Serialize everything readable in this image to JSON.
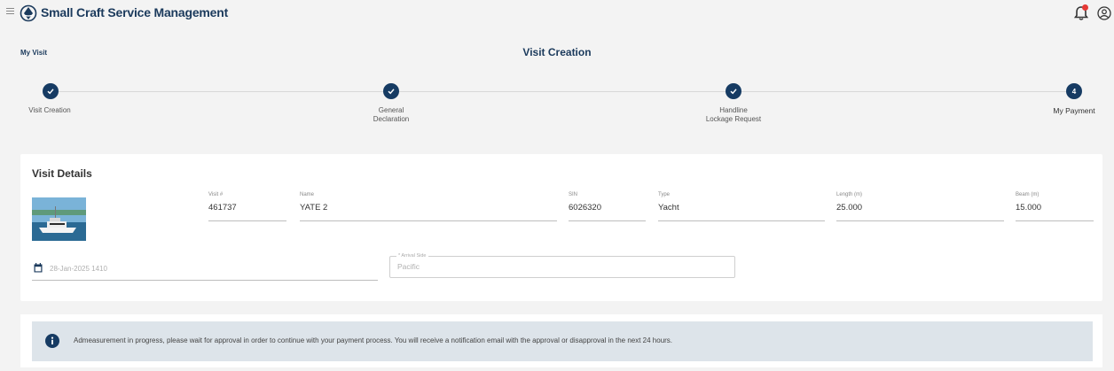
{
  "header": {
    "app_title": "Small Craft Service Management",
    "menu_icon": "hamburger-icon",
    "logo_icon": "ship-wheel-logo",
    "notification_icon": "bell-icon",
    "user_icon": "user-circle-icon"
  },
  "breadcrumb": "My Visit",
  "page_title": "Visit Creation",
  "stepper": {
    "steps": [
      {
        "label": "Visit Creation",
        "status": "done"
      },
      {
        "label": "General\nDeclaration",
        "status": "done"
      },
      {
        "label": "Handline\nLockage Request",
        "status": "done"
      },
      {
        "label": "My Payment",
        "status": "active",
        "number": "4"
      }
    ]
  },
  "visit_details": {
    "title": "Visit Details",
    "fields": [
      {
        "label": "Visit #",
        "value": "461737"
      },
      {
        "label": "Name",
        "value": "YATE 2"
      },
      {
        "label": "SIN",
        "value": "6026320"
      },
      {
        "label": "Type",
        "value": "Yacht"
      },
      {
        "label": "Length (m)",
        "value": "25.000"
      },
      {
        "label": "Beam (m)",
        "value": "15.000"
      }
    ],
    "date_value": "28-Jan-2025 1410",
    "arrival_label": "* Arrival Side",
    "arrival_value": "Pacific"
  },
  "notice": {
    "text": "Admeasurement in progress, please wait for approval in order to continue with your payment process. You will receive a notification email with the approval or disapproval in the next 24 hours."
  },
  "colors": {
    "primary": "#163b63",
    "title": "#1b3a5c",
    "notice_bg": "#dde4ea",
    "badge": "#e53935"
  }
}
